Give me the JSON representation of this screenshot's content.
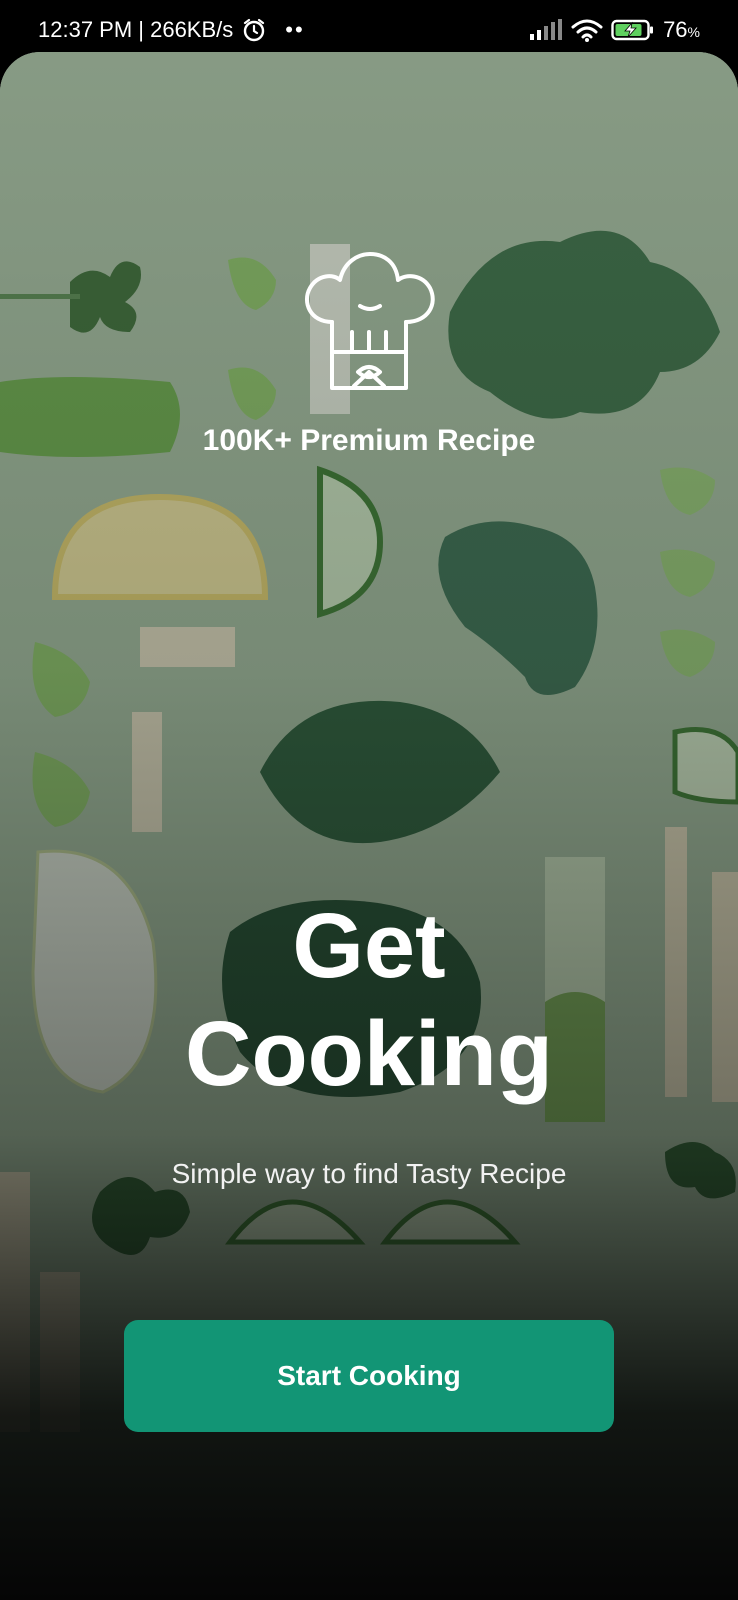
{
  "status_bar": {
    "time_speed": "12:37 PM | 266KB/s",
    "battery_percent": "76",
    "battery_unit": "%",
    "icons": [
      "alarm-icon",
      "signal-icon",
      "wifi-icon",
      "battery-charging-icon"
    ]
  },
  "splash": {
    "logo_icon": "chef-hat-icon",
    "tagline": "100K+ Premium Recipe",
    "headline_line1": "Get",
    "headline_line2": "Cooking",
    "subtitle": "Simple way to find Tasty Recipe",
    "cta_label": "Start Cooking"
  },
  "colors": {
    "accent": "#129575",
    "text": "#FFFFFF",
    "background_dark": "#000000"
  }
}
